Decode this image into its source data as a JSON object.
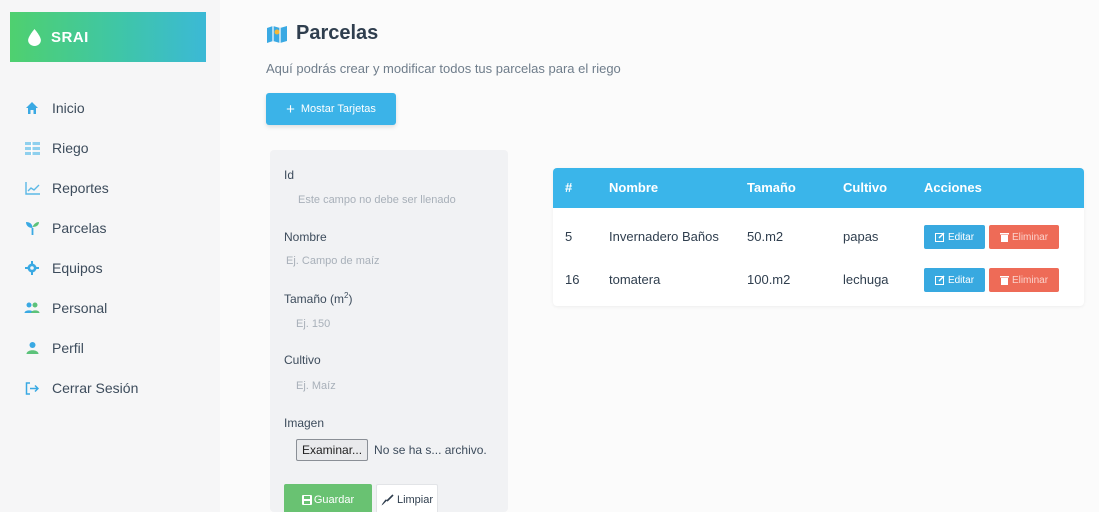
{
  "brand": {
    "name": "SRAI"
  },
  "sidebar": {
    "items": [
      {
        "label": "Inicio",
        "icon": "home-icon"
      },
      {
        "label": "Riego",
        "icon": "table-icon"
      },
      {
        "label": "Reportes",
        "icon": "chart-line-icon"
      },
      {
        "label": "Parcelas",
        "icon": "sprout-icon"
      },
      {
        "label": "Equipos",
        "icon": "gear-icon"
      },
      {
        "label": "Personal",
        "icon": "users-icon"
      },
      {
        "label": "Perfil",
        "icon": "user-icon"
      },
      {
        "label": "Cerrar Sesión",
        "icon": "logout-icon"
      }
    ]
  },
  "header": {
    "title": "Parcelas",
    "subtitle": "Aquí podrás crear y modificar todos tus parcelas para el riego",
    "cards_button": "Mostar Tarjetas"
  },
  "form": {
    "id_label": "Id",
    "id_placeholder": "Este campo no debe ser llenado",
    "nombre_label": "Nombre",
    "nombre_placeholder": "Ej. Campo de maíz",
    "tamano_label": "Tamaño (m",
    "tamano_sup": "2",
    "tamano_close": ")",
    "tamano_placeholder": "Ej. 150",
    "cultivo_label": "Cultivo",
    "cultivo_placeholder": "Ej. Maíz",
    "imagen_label": "Imagen",
    "file_button": "Examinar...",
    "file_status": "No se ha s... archivo.",
    "save_label": "Guardar",
    "clear_label": "Limpiar"
  },
  "table": {
    "columns": [
      "#",
      "Nombre",
      "Tamaño",
      "Cultivo",
      "Acciones"
    ],
    "rows": [
      {
        "id": "5",
        "nombre": "Invernadero Baños",
        "tamano": "50.m2",
        "cultivo": "papas"
      },
      {
        "id": "16",
        "nombre": "tomatera",
        "tamano": "100.m2",
        "cultivo": "lechuga"
      }
    ],
    "edit_label": "Editar",
    "delete_label": "Eliminar"
  },
  "colors": {
    "brand_gradient_start": "#4fd06f",
    "brand_gradient_end": "#3bb9d6",
    "primary": "#3ab5ea",
    "success": "#69c272",
    "danger": "#ee6b57"
  }
}
